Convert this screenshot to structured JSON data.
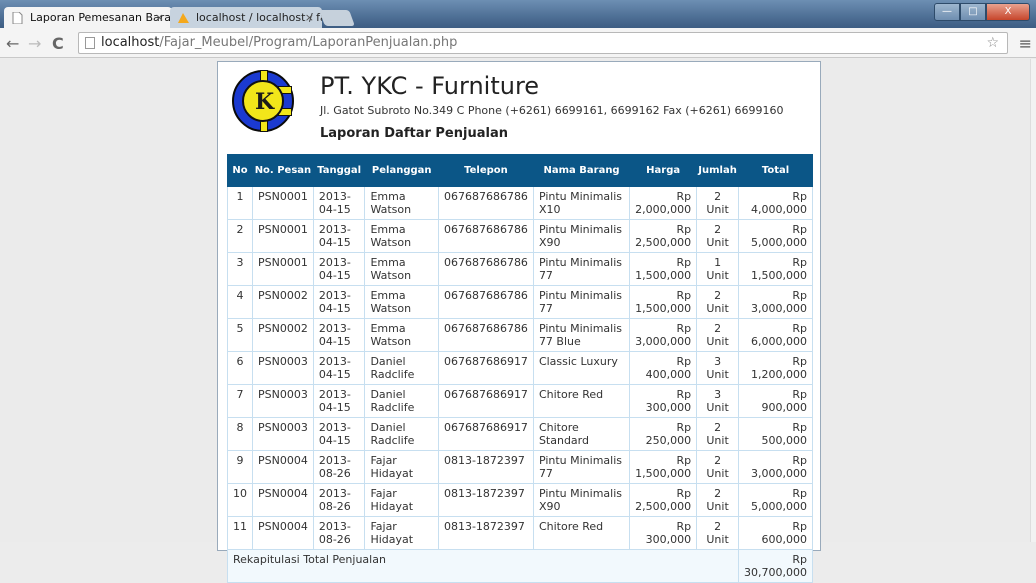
{
  "browser": {
    "tabs": [
      {
        "title": "Laporan Pemesanan Barai",
        "close": "×"
      },
      {
        "title": "localhost / localhost / faz",
        "close": "×"
      }
    ],
    "url_host": "localhost",
    "url_path": "/Fajar_Meubel/Program/LaporanPenjualan.php",
    "win_min": "—",
    "win_max": "□",
    "win_close": "X"
  },
  "report": {
    "company": "PT. YKC - Furniture",
    "address": "Jl. Gatot Subroto No.349 C Phone (+6261) 6699161, 6699162 Fax (+6261) 6699160",
    "subtitle": "Laporan Daftar Penjualan",
    "columns": [
      "No",
      "No. Pesan",
      "Tanggal",
      "Pelanggan",
      "Telepon",
      "Nama Barang",
      "Harga",
      "Jumlah",
      "Total"
    ],
    "rows": [
      {
        "no": "1",
        "pesan": "PSN0001",
        "tanggal": "2013-04-15",
        "pelanggan": "Emma Watson",
        "telepon": "067687686786",
        "barang": "Pintu Minimalis X10",
        "harga": "Rp 2,000,000",
        "jumlah": "2 Unit",
        "total": "Rp 4,000,000"
      },
      {
        "no": "2",
        "pesan": "PSN0001",
        "tanggal": "2013-04-15",
        "pelanggan": "Emma Watson",
        "telepon": "067687686786",
        "barang": "Pintu Minimalis X90",
        "harga": "Rp 2,500,000",
        "jumlah": "2 Unit",
        "total": "Rp 5,000,000"
      },
      {
        "no": "3",
        "pesan": "PSN0001",
        "tanggal": "2013-04-15",
        "pelanggan": "Emma Watson",
        "telepon": "067687686786",
        "barang": "Pintu Minimalis 77",
        "harga": "Rp 1,500,000",
        "jumlah": "1 Unit",
        "total": "Rp 1,500,000"
      },
      {
        "no": "4",
        "pesan": "PSN0002",
        "tanggal": "2013-04-15",
        "pelanggan": "Emma Watson",
        "telepon": "067687686786",
        "barang": "Pintu Minimalis 77",
        "harga": "Rp 1,500,000",
        "jumlah": "2 Unit",
        "total": "Rp 3,000,000"
      },
      {
        "no": "5",
        "pesan": "PSN0002",
        "tanggal": "2013-04-15",
        "pelanggan": "Emma Watson",
        "telepon": "067687686786",
        "barang": "Pintu Minimalis 77 Blue",
        "harga": "Rp 3,000,000",
        "jumlah": "2 Unit",
        "total": "Rp 6,000,000"
      },
      {
        "no": "6",
        "pesan": "PSN0003",
        "tanggal": "2013-04-15",
        "pelanggan": "Daniel Radclife",
        "telepon": "067687686917",
        "barang": "Classic Luxury",
        "harga": "Rp 400,000",
        "jumlah": "3 Unit",
        "total": "Rp 1,200,000"
      },
      {
        "no": "7",
        "pesan": "PSN0003",
        "tanggal": "2013-04-15",
        "pelanggan": "Daniel Radclife",
        "telepon": "067687686917",
        "barang": "Chitore Red",
        "harga": "Rp 300,000",
        "jumlah": "3 Unit",
        "total": "Rp 900,000"
      },
      {
        "no": "8",
        "pesan": "PSN0003",
        "tanggal": "2013-04-15",
        "pelanggan": "Daniel Radclife",
        "telepon": "067687686917",
        "barang": "Chitore Standard",
        "harga": "Rp 250,000",
        "jumlah": "2 Unit",
        "total": "Rp 500,000"
      },
      {
        "no": "9",
        "pesan": "PSN0004",
        "tanggal": "2013-08-26",
        "pelanggan": "Fajar Hidayat",
        "telepon": "0813-1872397",
        "barang": "Pintu Minimalis 77",
        "harga": "Rp 1,500,000",
        "jumlah": "2 Unit",
        "total": "Rp 3,000,000"
      },
      {
        "no": "10",
        "pesan": "PSN0004",
        "tanggal": "2013-08-26",
        "pelanggan": "Fajar Hidayat",
        "telepon": "0813-1872397",
        "barang": "Pintu Minimalis X90",
        "harga": "Rp 2,500,000",
        "jumlah": "2 Unit",
        "total": "Rp 5,000,000"
      },
      {
        "no": "11",
        "pesan": "PSN0004",
        "tanggal": "2013-08-26",
        "pelanggan": "Fajar Hidayat",
        "telepon": "0813-1872397",
        "barang": "Chitore Red",
        "harga": "Rp 300,000",
        "jumlah": "2 Unit",
        "total": "Rp 600,000"
      }
    ],
    "summary_label": "Rekapitulasi Total Penjualan",
    "summary_total": "Rp 30,700,000"
  }
}
